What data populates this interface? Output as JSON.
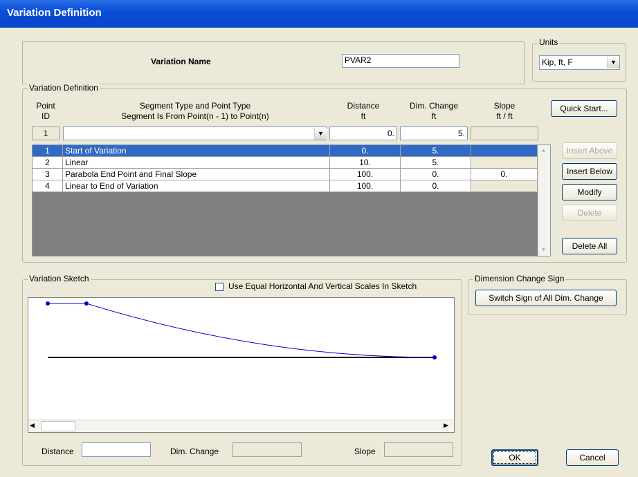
{
  "window": {
    "title": "Variation Definition"
  },
  "header": {
    "variation_name_label": "Variation Name",
    "variation_name_value": "PVAR2"
  },
  "units": {
    "legend": "Units",
    "selected": "Kip, ft, F"
  },
  "definition": {
    "legend": "Variation Definition",
    "columns": {
      "point_id": [
        "Point",
        "ID"
      ],
      "segment": [
        "Segment Type and Point Type",
        "Segment Is From Point(n - 1) to Point(n)"
      ],
      "distance": [
        "Distance",
        "ft"
      ],
      "dim_change": [
        "Dim. Change",
        "ft"
      ],
      "slope": [
        "Slope",
        "ft / ft"
      ]
    },
    "edit_row": {
      "point_id": "1",
      "segment": "",
      "distance": "0.",
      "dim_change": "5.",
      "slope": ""
    },
    "rows": [
      {
        "id": "1",
        "segment": "Start of Variation",
        "distance": "0.",
        "dim_change": "5.",
        "slope": "",
        "selected": true
      },
      {
        "id": "2",
        "segment": "Linear",
        "distance": "10.",
        "dim_change": "5.",
        "slope": ""
      },
      {
        "id": "3",
        "segment": "Parabola End Point and Final Slope",
        "distance": "100.",
        "dim_change": "0.",
        "slope": "0."
      },
      {
        "id": "4",
        "segment": "Linear to End of Variation",
        "distance": "100.",
        "dim_change": "0.",
        "slope": ""
      }
    ]
  },
  "buttons": {
    "quick_start": "Quick Start...",
    "insert_above": "Insert Above",
    "insert_below": "Insert Below",
    "modify": "Modify",
    "delete": "Delete",
    "delete_all": "Delete All",
    "switch_sign": "Switch Sign of All Dim. Change",
    "ok": "OK",
    "cancel": "Cancel"
  },
  "sketch": {
    "legend": "Variation Sketch",
    "equal_scales_label": "Use Equal Horizontal And Vertical Scales In Sketch",
    "equal_scales_checked": false,
    "distance_label": "Distance",
    "distance_value": "",
    "dim_change_label": "Dim. Change",
    "dim_change_value": "",
    "slope_label": "Slope",
    "slope_value": "",
    "line_color": "#0000cc",
    "baseline_color": "#000000"
  },
  "sign": {
    "legend": "Dimension Change Sign"
  }
}
